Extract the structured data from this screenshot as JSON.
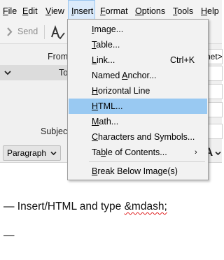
{
  "menubar": {
    "items": [
      {
        "label": "File"
      },
      {
        "label": "Edit"
      },
      {
        "label": "View"
      },
      {
        "label": "Insert"
      },
      {
        "label": "Format"
      },
      {
        "label": "Options"
      },
      {
        "label": "Tools"
      },
      {
        "label": "Help"
      }
    ],
    "active": "Insert"
  },
  "toolbar": {
    "send_label": "Send",
    "spell_icon": "spell-check-icon",
    "partial_label": "S"
  },
  "headers": {
    "from_label": "From",
    "to_label": "To",
    "subject_label": "Subject",
    "from_value_partial": "net>"
  },
  "format_bar": {
    "paragraph_value": "Paragraph",
    "font_glyph": "A"
  },
  "insert_menu": {
    "items": [
      {
        "label": "Image...",
        "underline_index": 0
      },
      {
        "label": "Table...",
        "underline_index": 0
      },
      {
        "label": "Link...",
        "shortcut": "Ctrl+K",
        "underline_index": 0
      },
      {
        "label": "Named Anchor...",
        "underline_index": 6
      },
      {
        "label": "Horizontal Line",
        "underline_index": 0
      },
      {
        "label": "HTML...",
        "underline_index": 0,
        "highlighted": true
      },
      {
        "label": "Math...",
        "underline_index": 0
      },
      {
        "label": "Characters and Symbols...",
        "underline_index": 0
      },
      {
        "label": "Table of Contents...",
        "underline_index": 2,
        "submenu": true
      },
      {
        "label": "Break Below Image(s)",
        "underline_index": 0
      }
    ]
  },
  "body": {
    "line1_prefix": "— Insert/HTML and type ",
    "line1_code": "&mdash;",
    "line2": "—"
  },
  "colors": {
    "menu_highlight": "#99c9f2",
    "active_menubar": "#dcebfb",
    "spell_error": "#e02020"
  }
}
